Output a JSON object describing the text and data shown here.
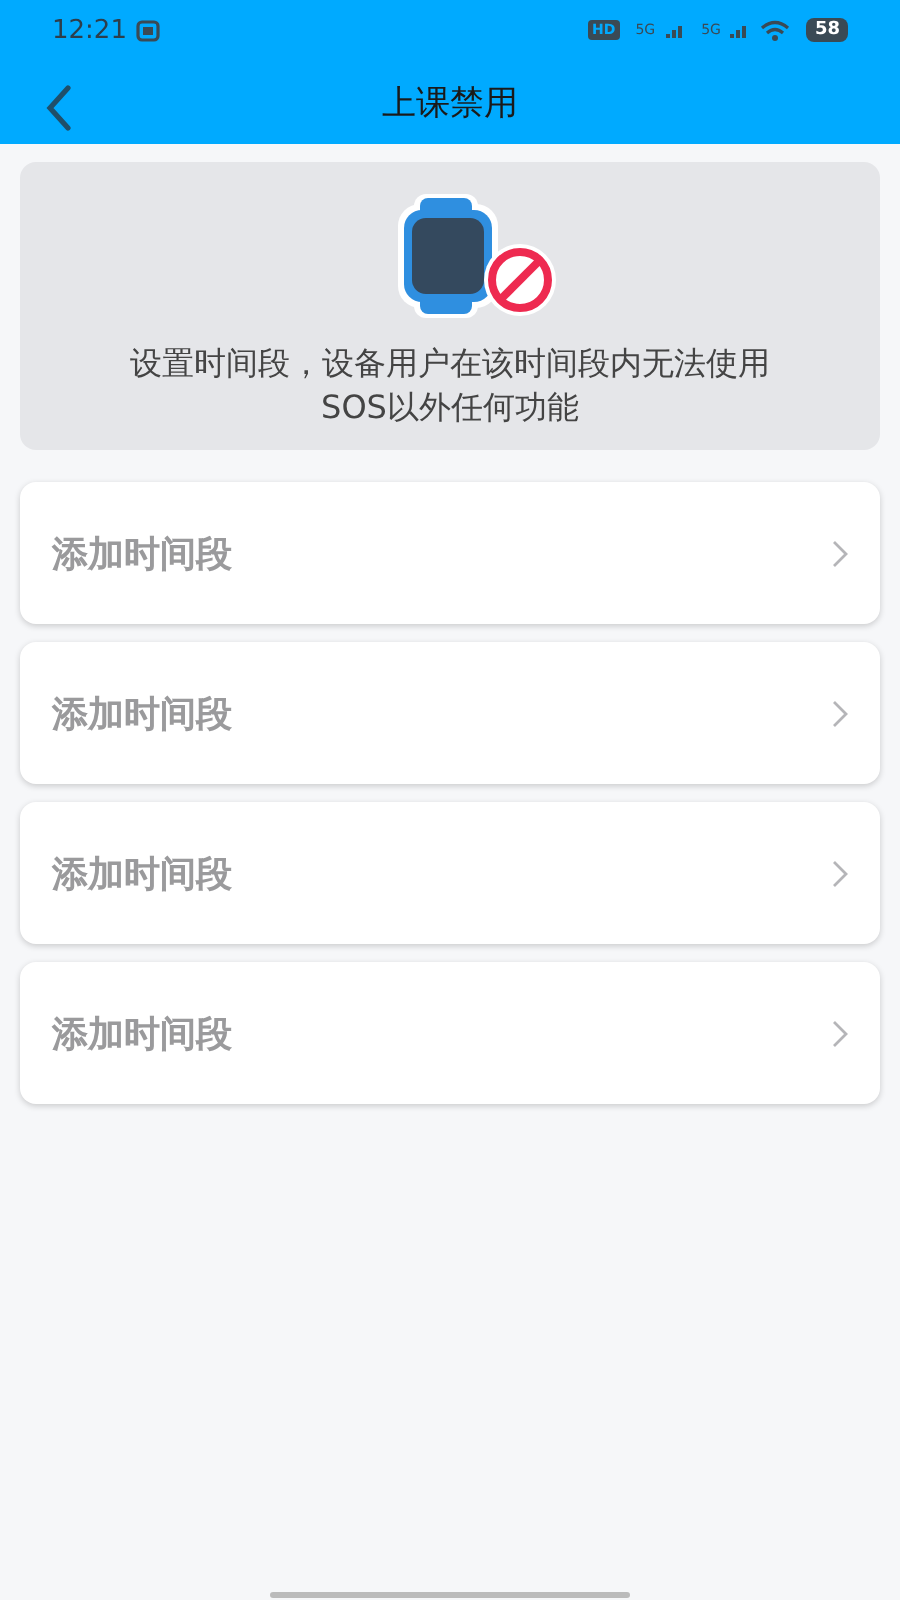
{
  "status_bar": {
    "time": "12:21",
    "network_labels": [
      "HD",
      "5G",
      "5G"
    ],
    "battery": "58"
  },
  "header": {
    "title": "上课禁用"
  },
  "banner": {
    "text": "设置时间段，设备用户在该时间段内无法使用SOS以外任何功能"
  },
  "slots": [
    {
      "label": "添加时间段"
    },
    {
      "label": "添加时间段"
    },
    {
      "label": "添加时间段"
    },
    {
      "label": "添加时间段"
    }
  ]
}
